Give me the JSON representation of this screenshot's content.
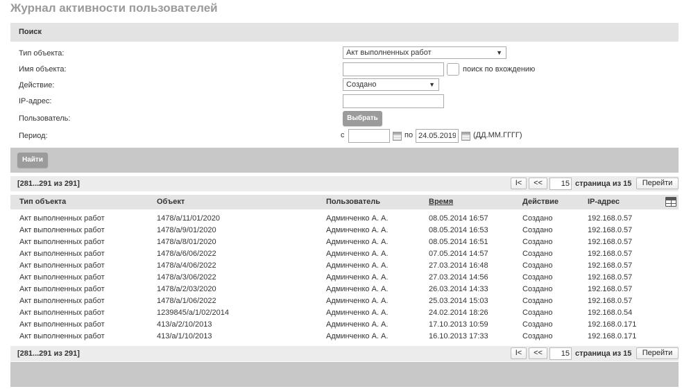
{
  "page": {
    "title": "Журнал активности пользователей"
  },
  "search": {
    "header": "Поиск",
    "labels": {
      "object_type": "Тип объекта:",
      "object_name": "Имя объекта:",
      "action": "Действие:",
      "ip": "IP-адрес:",
      "user": "Пользователь:",
      "period": "Период:"
    },
    "object_type_value": "Акт выполненных работ",
    "object_name_value": "",
    "substring_label": "поиск по вхождению",
    "action_value": "Создано",
    "ip_value": "",
    "select_button": "Выбрать",
    "period_from_label": "с",
    "period_from_value": "",
    "period_to_label": "по",
    "period_to_value": "24.05.2019",
    "date_format_hint": "(ДД.ММ.ГГГГ)",
    "find_button": "Найти"
  },
  "pager": {
    "range": "[281...291 из 291]",
    "first_label": "I<",
    "prev_label": "<<",
    "page_value": "15",
    "page_of": "страница из 15",
    "go_label": "Перейти"
  },
  "table": {
    "columns": {
      "object_type": "Тип объекта",
      "object": "Объект",
      "user": "Пользователь",
      "time": "Время",
      "action": "Действие",
      "ip": "IP-адрес"
    },
    "rows": [
      {
        "object_type": "Акт выполненных работ",
        "object": "1478/а/11/01/2020",
        "user": "Админченко А. А.",
        "time": "08.05.2014 16:57",
        "action": "Создано",
        "ip": "192.168.0.57"
      },
      {
        "object_type": "Акт выполненных работ",
        "object": "1478/а/9/01/2020",
        "user": "Админченко А. А.",
        "time": "08.05.2014 16:53",
        "action": "Создано",
        "ip": "192.168.0.57"
      },
      {
        "object_type": "Акт выполненных работ",
        "object": "1478/а/8/01/2020",
        "user": "Админченко А. А.",
        "time": "08.05.2014 16:51",
        "action": "Создано",
        "ip": "192.168.0.57"
      },
      {
        "object_type": "Акт выполненных работ",
        "object": "1478/а/6/06/2022",
        "user": "Админченко А. А.",
        "time": "07.05.2014 14:57",
        "action": "Создано",
        "ip": "192.168.0.57"
      },
      {
        "object_type": "Акт выполненных работ",
        "object": "1478/а/4/06/2022",
        "user": "Админченко А. А.",
        "time": "27.03.2014 16:48",
        "action": "Создано",
        "ip": "192.168.0.57"
      },
      {
        "object_type": "Акт выполненных работ",
        "object": "1478/а/3/06/2022",
        "user": "Админченко А. А.",
        "time": "27.03.2014 14:56",
        "action": "Создано",
        "ip": "192.168.0.57"
      },
      {
        "object_type": "Акт выполненных работ",
        "object": "1478/а/2/03/2020",
        "user": "Админченко А. А.",
        "time": "26.03.2014 14:33",
        "action": "Создано",
        "ip": "192.168.0.57"
      },
      {
        "object_type": "Акт выполненных работ",
        "object": "1478/а/1/06/2022",
        "user": "Админченко А. А.",
        "time": "25.03.2014 15:03",
        "action": "Создано",
        "ip": "192.168.0.57"
      },
      {
        "object_type": "Акт выполненных работ",
        "object": "1239845/а/1/02/2014",
        "user": "Админченко А. А.",
        "time": "24.02.2014 18:26",
        "action": "Создано",
        "ip": "192.168.0.54"
      },
      {
        "object_type": "Акт выполненных работ",
        "object": "413/а/2/10/2013",
        "user": "Админченко А. А.",
        "time": "17.10.2013 10:59",
        "action": "Создано",
        "ip": "192.168.0.171"
      },
      {
        "object_type": "Акт выполненных работ",
        "object": "413/а/1/10/2013",
        "user": "Админченко А. А.",
        "time": "16.10.2013 17:33",
        "action": "Создано",
        "ip": "192.168.0.171"
      }
    ]
  }
}
